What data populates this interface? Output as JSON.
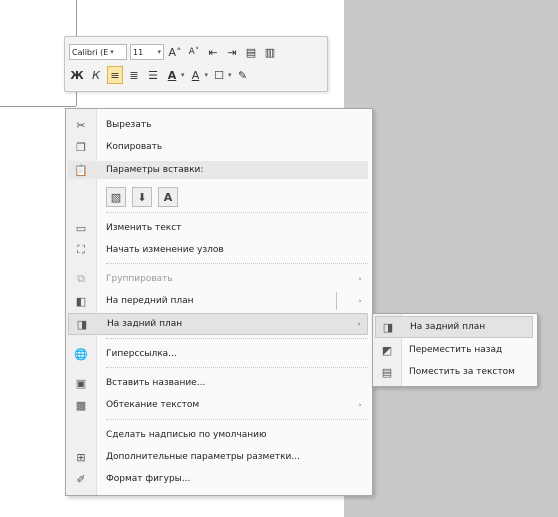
{
  "mini_toolbar": {
    "font_name": "Calibri (E",
    "font_size": "11",
    "grow_font": "A˄",
    "shrink_font": "A˅",
    "bold": "Ж",
    "italic": "К",
    "font_color": "A",
    "highlight": "А"
  },
  "context_menu": {
    "cut": "Вырезать",
    "copy": "Копировать",
    "paste_options_header": "Параметры вставки:",
    "paste_option_text": "A",
    "edit_text": "Изменить текст",
    "edit_points": "Начать изменение узлов",
    "group": "Группировать",
    "bring_to_front": "На передний план",
    "send_to_back": "На задний план",
    "hyperlink": "Гиперссылка...",
    "insert_caption": "Вставить название...",
    "text_wrapping": "Обтекание текстом",
    "set_default": "Сделать надписью по умолчанию",
    "more_layout": "Дополнительные параметры разметки...",
    "format_shape": "Формат фигуры..."
  },
  "submenu": {
    "send_to_back": "На задний план",
    "send_backward": "Переместить назад",
    "behind_text": "Поместить за текстом"
  },
  "colors": {
    "highlight_bg": "#e3e3e3",
    "gray_area": "#c9c9c9",
    "active_button": "#fbe7a8"
  }
}
